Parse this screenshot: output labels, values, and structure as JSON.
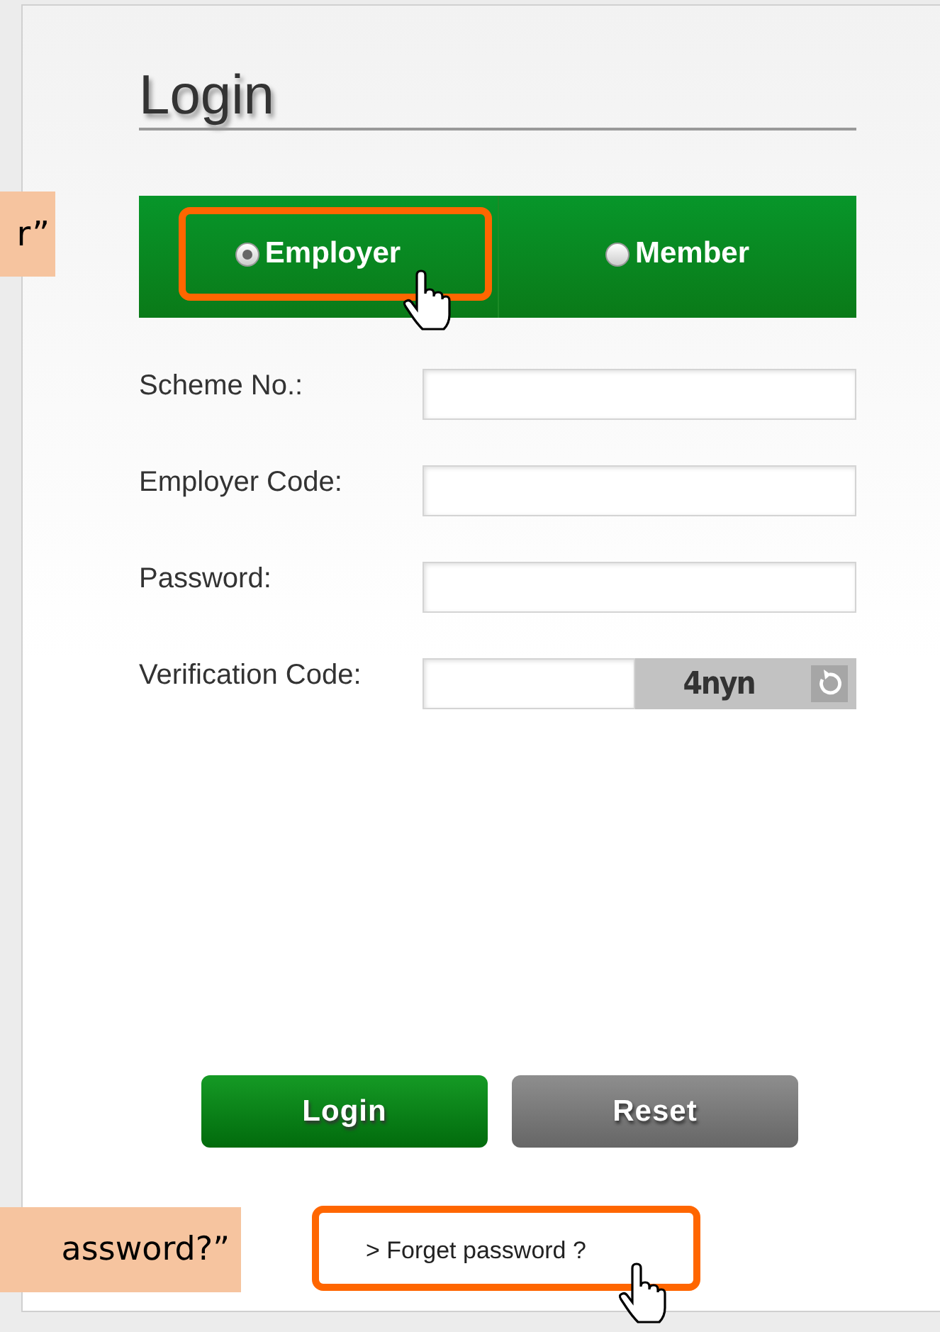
{
  "title": "Login",
  "user_types": [
    {
      "label": "Employer",
      "selected": true
    },
    {
      "label": "Member",
      "selected": false
    }
  ],
  "fields": [
    {
      "label": "Scheme No.:",
      "kind": "text"
    },
    {
      "label": "Employer Code:",
      "kind": "text"
    },
    {
      "label": "Password:",
      "kind": "password"
    },
    {
      "label": "Verification Code:",
      "kind": "captcha",
      "captcha": "4nyn"
    }
  ],
  "buttons": [
    {
      "label": "Login",
      "kind": "primary"
    },
    {
      "label": "Reset",
      "kind": "secondary"
    }
  ],
  "forgot_link": "> Forget password ?",
  "callouts": [
    {
      "text": "r”"
    },
    {
      "text": "assword?”"
    }
  ]
}
